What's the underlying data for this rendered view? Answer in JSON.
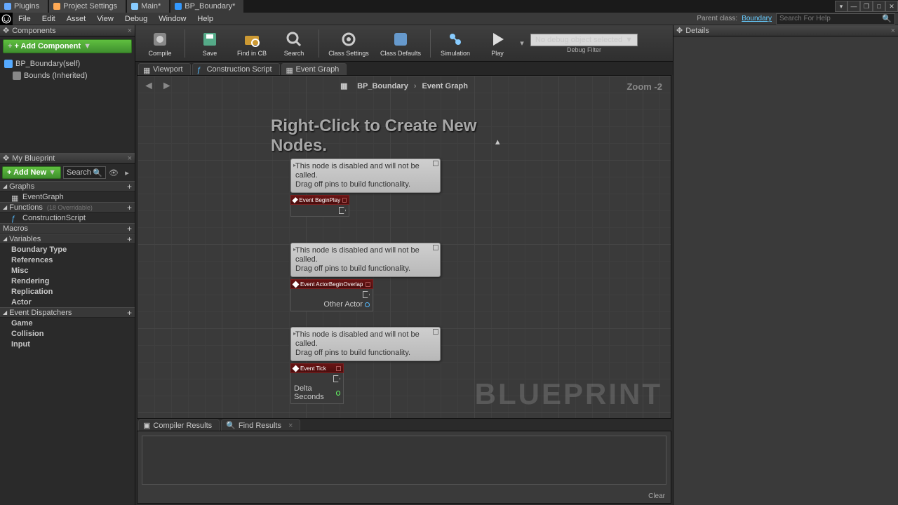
{
  "topTabs": [
    "Plugins",
    "Project Settings",
    "Main*",
    "BP_Boundary*"
  ],
  "menu": [
    "File",
    "Edit",
    "Asset",
    "View",
    "Debug",
    "Window",
    "Help"
  ],
  "parentLabel": "Parent class:",
  "parentClass": "Boundary",
  "searchPlaceholder": "Search For Help",
  "panels": {
    "components": "Components",
    "myBlueprint": "My Blueprint",
    "details": "Details"
  },
  "addComponent": "+ Add Component",
  "compTree": {
    "root": "BP_Boundary(self)",
    "child": "Bounds (Inherited)"
  },
  "addNew": "+ Add New",
  "miniSearch": "Search",
  "categories": {
    "graphs": {
      "head": "Graphs",
      "items": [
        "EventGraph"
      ]
    },
    "functions": {
      "head": "Functions",
      "hint": "(18 Overridable)",
      "items": [
        "ConstructionScript"
      ]
    },
    "macros": {
      "head": "Macros",
      "items": []
    },
    "variables": {
      "head": "Variables",
      "items": [
        "Boundary Type",
        "References",
        "Misc",
        "Rendering",
        "Replication",
        "Actor"
      ]
    },
    "eventDispatchers": {
      "head": "Event Dispatchers",
      "items": [
        "Game",
        "Collision",
        "Input"
      ]
    }
  },
  "toolbar": [
    "Compile",
    "Save",
    "Find in CB",
    "Search",
    "Class Settings",
    "Class Defaults",
    "Simulation",
    "Play"
  ],
  "debugSel": "No debug object selected",
  "debugFilter": "Debug Filter",
  "editorTabs": [
    "Viewport",
    "Construction Script",
    "Event Graph"
  ],
  "breadcrumb": {
    "a": "BP_Boundary",
    "b": "Event Graph"
  },
  "zoom": "Zoom -2",
  "graphHint": "Right-Click to Create New Nodes.",
  "nodeTooltip": "This node is disabled and will not be called.\nDrag off pins to build functionality.",
  "nodes": {
    "beginPlay": "Event BeginPlay",
    "overlap": "Event ActorBeginOverlap",
    "overlapPin": "Other Actor",
    "tick": "Event Tick",
    "tickPin": "Delta Seconds"
  },
  "watermark": "BLUEPRINT",
  "bottomTabs": [
    "Compiler Results",
    "Find Results"
  ],
  "clear": "Clear"
}
